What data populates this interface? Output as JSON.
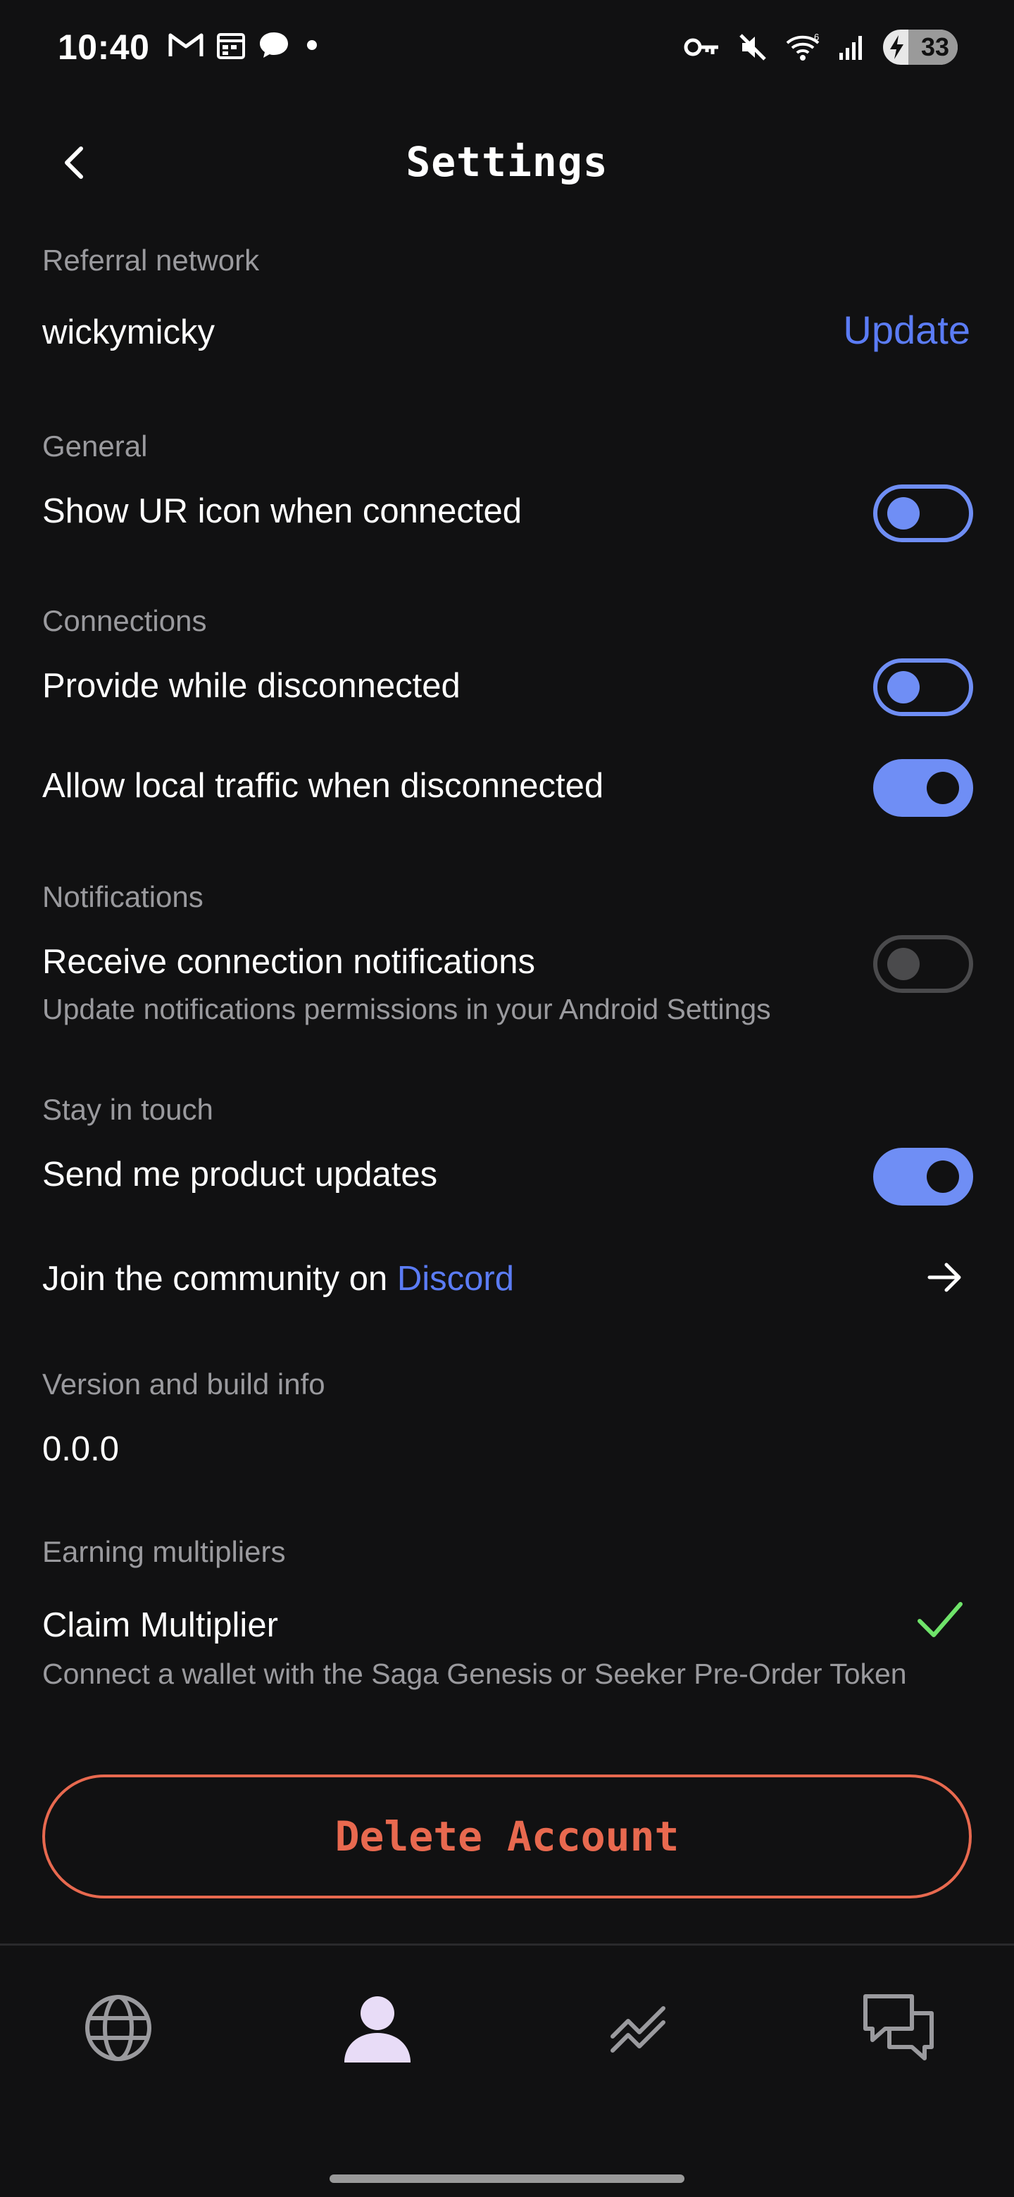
{
  "status_bar": {
    "time": "10:40",
    "battery": "33",
    "left_icons": [
      "gmail-icon",
      "calendar-icon",
      "chat-icon",
      "dot-icon"
    ],
    "right_icons": [
      "vpn-key-icon",
      "mute-icon",
      "wifi-icon",
      "signal-icon",
      "battery-icon"
    ]
  },
  "header": {
    "title": "Settings",
    "back_icon": "chevron-left-icon"
  },
  "referral": {
    "label": "Referral network",
    "value": "wickymicky",
    "update_label": "Update"
  },
  "general": {
    "label": "General",
    "show_ur_icon": {
      "text": "Show UR icon when connected",
      "enabled": false
    }
  },
  "connections": {
    "label": "Connections",
    "provide_disconnected": {
      "text": "Provide while disconnected",
      "enabled": false
    },
    "allow_local_traffic": {
      "text": "Allow local traffic when disconnected",
      "enabled": true
    }
  },
  "notifications": {
    "label": "Notifications",
    "receive": {
      "text": "Receive connection notifications",
      "subtext": "Update notifications permissions in your Android Settings",
      "enabled": false,
      "disabled": true
    }
  },
  "stay_in_touch": {
    "label": "Stay in touch",
    "product_updates": {
      "text": "Send me product updates",
      "enabled": true
    },
    "community_prefix": "Join the community on ",
    "community_link": "Discord"
  },
  "version": {
    "label": "Version and build info",
    "value": "0.0.0"
  },
  "multipliers": {
    "label": "Earning multipliers",
    "claim_title": "Claim Multiplier",
    "claim_subtext": "Connect a wallet with the Saga Genesis or Seeker Pre-Order Token"
  },
  "delete_label": "Delete Account",
  "bottom_nav": [
    "globe-icon",
    "profile-icon",
    "chart-icon",
    "chat-bubbles-icon"
  ],
  "colors": {
    "accent": "#6f8ef5",
    "link": "#5b7cf5",
    "danger": "#e8694f",
    "success": "#6fe36a",
    "background": "#111112"
  }
}
